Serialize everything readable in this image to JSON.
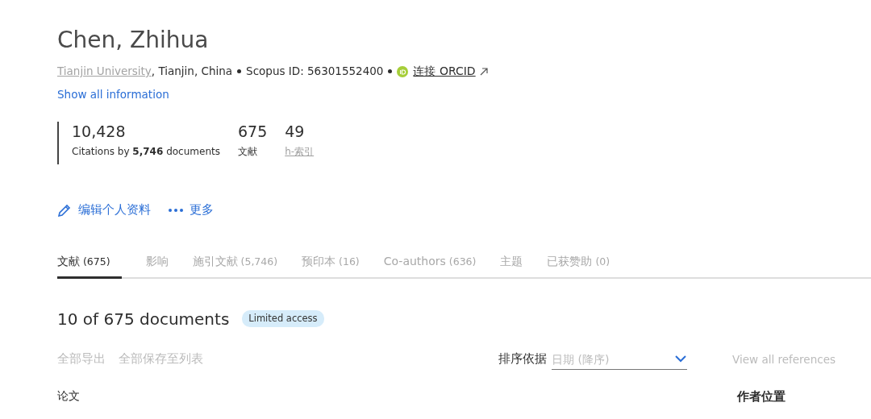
{
  "author": {
    "name": "Chen, Zhihua",
    "affiliation": "Tianjin University",
    "location": ", Tianjin, China",
    "scopus_id": "Scopus ID: 56301552400",
    "orcid_link": "连接 ORCID",
    "show_all": "Show all information"
  },
  "metrics": [
    {
      "value": "10,428",
      "label": "Citations by **5,746** documents",
      "kind": "text"
    },
    {
      "value": "675",
      "label": "文献",
      "kind": "text"
    },
    {
      "value": "49",
      "label": "h-索引",
      "kind": "link"
    }
  ],
  "profile_actions": [
    {
      "label": "编辑个人资料",
      "kind": "edit"
    },
    {
      "label": "更多",
      "kind": "more"
    }
  ],
  "tabs": [
    {
      "label": "文献",
      "count": "(675)",
      "selected": true
    },
    {
      "label": "影响",
      "selected": false
    },
    {
      "label": "施引文献",
      "count": "(5,746)",
      "selected": false
    },
    {
      "label": "预印本",
      "count": "(16)",
      "selected": false
    },
    {
      "label": "Co-authors",
      "count": "(636)",
      "selected": false
    },
    {
      "label": "主题",
      "selected": false
    },
    {
      "label": "已获赞助",
      "count": "(0)",
      "selected": false
    }
  ],
  "results": {
    "heading": "10 of 675 documents",
    "badge": "Limited access"
  },
  "toolbar": {
    "actions": [
      {
        "label": "全部导出",
        "disabled": true
      },
      {
        "label": "全部保存至列表",
        "disabled": true
      }
    ],
    "sort_label": "排序依据",
    "sort": {
      "placeholder": "日期 (降序)"
    },
    "view_all": {
      "label": "View all references",
      "disabled": true
    }
  },
  "list_header": {
    "column_1": "论文",
    "column_2": "作者位置"
  }
}
